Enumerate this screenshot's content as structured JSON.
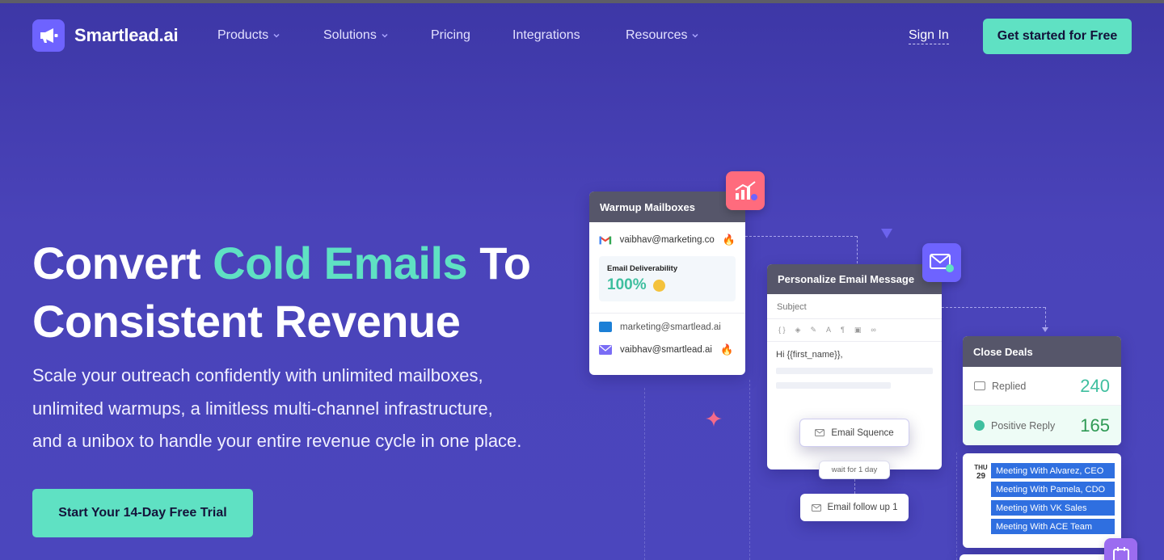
{
  "nav": {
    "brand": "Smartlead.ai",
    "items": [
      {
        "label": "Products",
        "has_dropdown": true
      },
      {
        "label": "Solutions",
        "has_dropdown": true
      },
      {
        "label": "Pricing",
        "has_dropdown": false
      },
      {
        "label": "Integrations",
        "has_dropdown": false
      },
      {
        "label": "Resources",
        "has_dropdown": true
      }
    ],
    "sign_in": "Sign In",
    "cta": "Get started for Free"
  },
  "hero": {
    "title_part1": "Convert ",
    "title_accent": "Cold Emails",
    "title_part2": " To",
    "title_line2": "Consistent Revenue",
    "subtitle_line1": "Scale your outreach confidently with unlimited mailboxes,",
    "subtitle_line2": "unlimited warmups, a limitless multi-channel infrastructure,",
    "subtitle_line3": "and a unibox to handle your entire revenue cycle in one place.",
    "cta": "Start Your 14-Day Free Trial"
  },
  "illustration": {
    "warmup": {
      "title": "Warmup Mailboxes",
      "email1": "vaibhav@marketing.co",
      "deliverability_label": "Email Deliverability",
      "deliverability_value": "100%",
      "email2": "marketing@smartlead.ai",
      "email3": "vaibhav@smartlead.ai"
    },
    "personalize": {
      "title": "Personalize Email Message",
      "subject_label": "Subject",
      "body": "Hi {{first_name}},",
      "sequence_button": "Email Squence",
      "wait_label": "wait for 1 day",
      "followup_button": "Email follow up 1"
    },
    "close": {
      "title": "Close Deals",
      "replied_label": "Replied",
      "replied_value": "240",
      "positive_label": "Positive Reply",
      "positive_value": "165"
    },
    "calendar": {
      "day_name": "THU",
      "day_num": "29",
      "meetings": [
        "Meeting With Alvarez, CEO",
        "Meeting With Pamela, CDO",
        "Meeting With VK Sales",
        "Meeting With ACE Team"
      ]
    }
  },
  "colors": {
    "background": "#4a43b9",
    "accent": "#5fe1c3",
    "brand": "#6e63ff",
    "card_header": "#56566a",
    "meeting_blue": "#2f6fe0"
  }
}
